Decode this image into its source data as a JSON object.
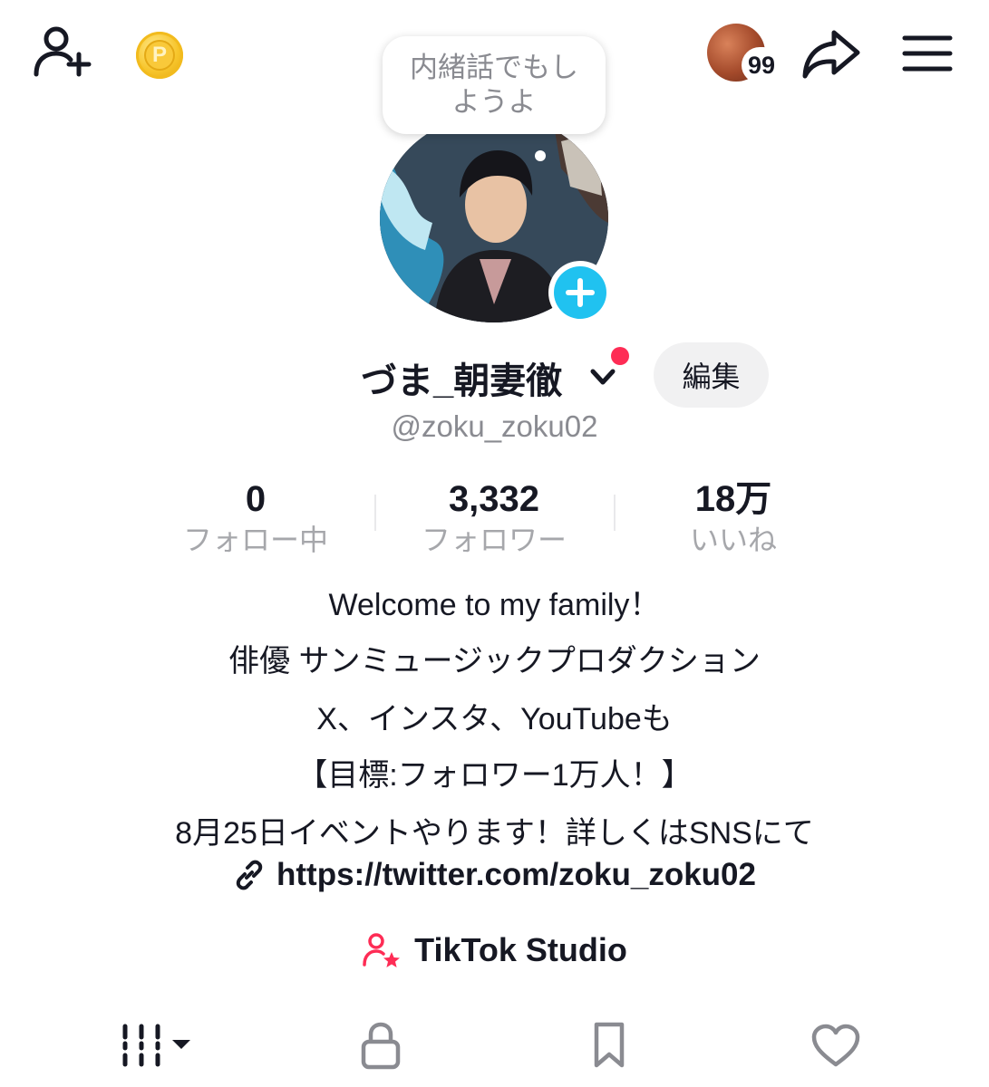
{
  "topbar": {
    "notification_count": "99",
    "coin_letter": "P"
  },
  "bubble": {
    "text": "内緒話でもしようよ"
  },
  "profile": {
    "display_name": "づま_朝妻徹",
    "edit_label": "編集",
    "username": "@zoku_zoku02"
  },
  "stats": [
    {
      "value": "0",
      "label": "フォロー中"
    },
    {
      "value": "3,332",
      "label": "フォロワー"
    },
    {
      "value": "18万",
      "label": "いいね"
    }
  ],
  "bio": {
    "lines": [
      "Welcome to my family！",
      "俳優 サンミュージックプロダクション",
      "X、インスタ、YouTubeも",
      "【目標:フォロワー1万人！】",
      "8月25日イベントやります！詳しくはSNSにて"
    ],
    "link": "https://twitter.com/zoku_zoku02"
  },
  "studio": {
    "label": "TikTok Studio"
  },
  "tabs": [
    {
      "icon": "videos-grid-icon"
    },
    {
      "icon": "lock-icon"
    },
    {
      "icon": "bookmark-icon"
    },
    {
      "icon": "heart-icon"
    }
  ],
  "colors": {
    "accent_red": "#fe2c55",
    "plus_blue": "#20c2f0",
    "muted_text": "#8a8b91"
  }
}
